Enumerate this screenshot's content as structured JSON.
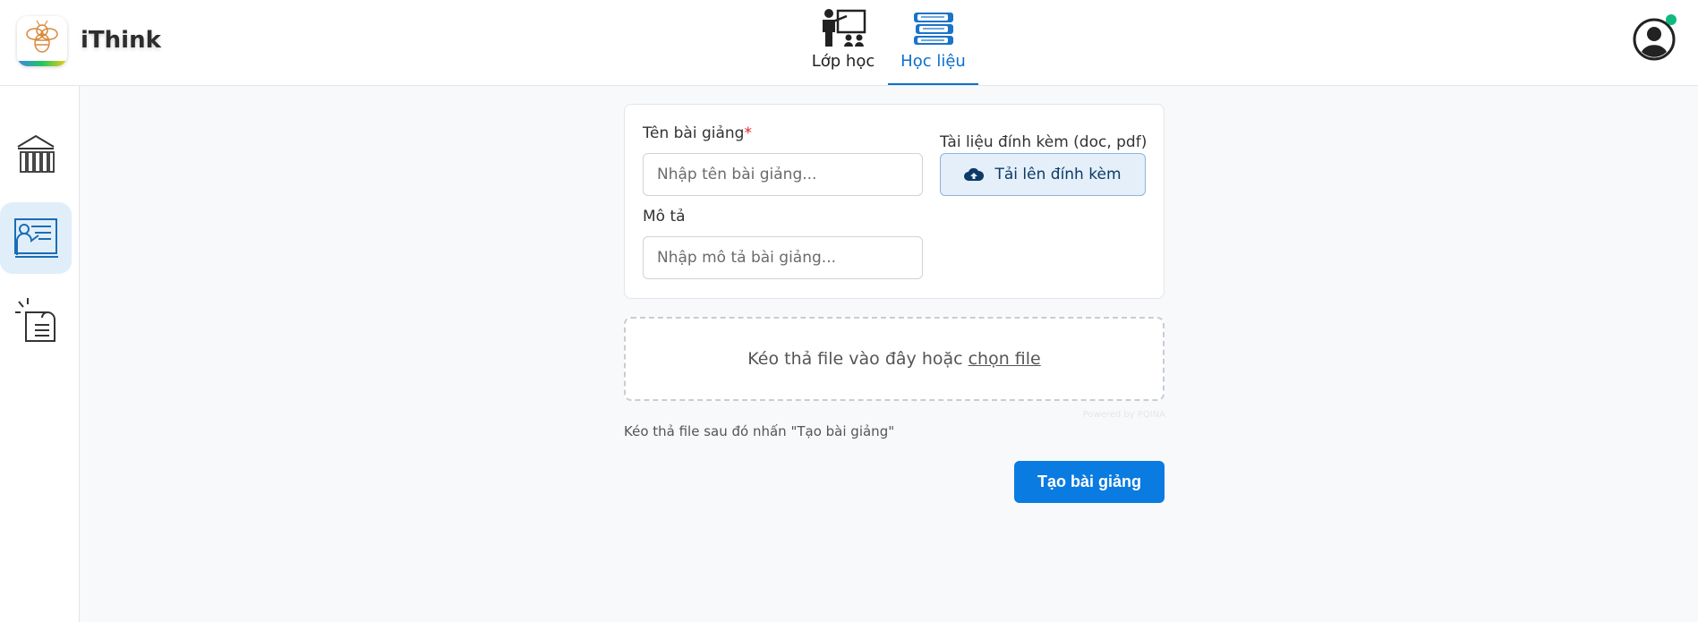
{
  "app": {
    "name": "iThink"
  },
  "nav": {
    "tabs": [
      {
        "label": "Lớp học",
        "active": false
      },
      {
        "label": "Học liệu",
        "active": true
      }
    ],
    "accent_color": "#0b6fcf"
  },
  "user": {
    "status": "online",
    "status_color": "#10b981"
  },
  "sidebar": {
    "items": [
      {
        "name": "library",
        "icon": "library-building-icon",
        "active": false
      },
      {
        "name": "lectures",
        "icon": "teacher-board-icon",
        "active": true
      },
      {
        "name": "documents",
        "icon": "document-icon",
        "active": false
      }
    ]
  },
  "form": {
    "title_label": "Tên bài giảng",
    "required_mark": "*",
    "title_placeholder": "Nhập tên bài giảng...",
    "description_label": "Mô tả",
    "description_placeholder": "Nhập mô tả bài giảng...",
    "attachment_label": "Tài liệu đính kèm (doc, pdf)",
    "upload_button": "Tải lên đính kèm"
  },
  "dropzone": {
    "text": "Kéo thả file vào đây hoặc",
    "link": "chọn file",
    "powered_by": "Powered by PQINA"
  },
  "hint": "Kéo thả file sau đó nhấn \"Tạo bài giảng\"",
  "create_button": "Tạo bài giảng"
}
